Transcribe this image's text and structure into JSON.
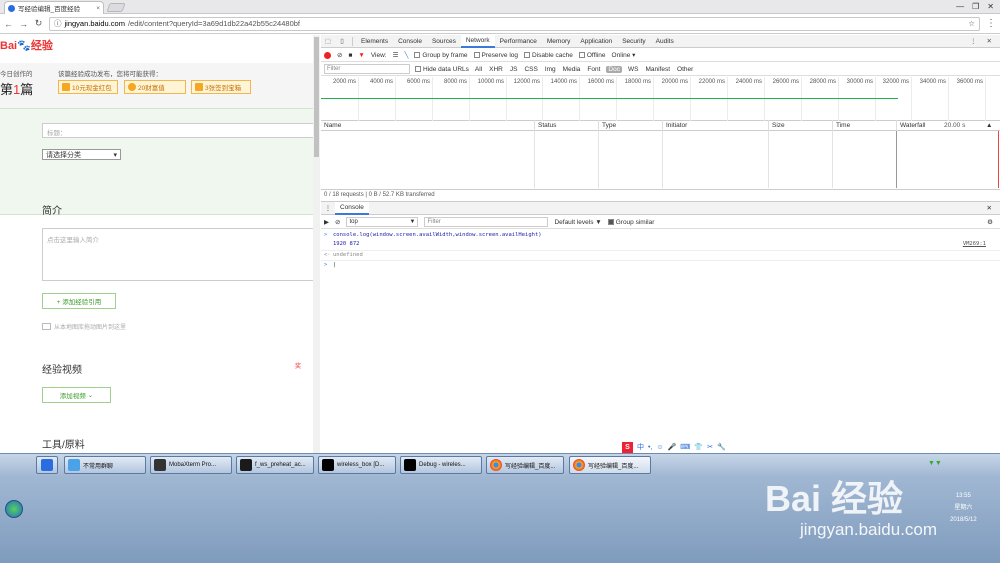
{
  "browser": {
    "tab_title": "写经验编辑_百度经验",
    "tab_close": "×",
    "window_controls": [
      "—",
      "❐",
      "✕"
    ],
    "url_prefix": "jingyan.baidu.com",
    "url_rest": "/edit/content?queryId=3a69d1db22a42b55c24480bf"
  },
  "page": {
    "logo_text": "Bai",
    "logo_suffix": "经验",
    "created_label": "今日创作的",
    "first_label_a": "第",
    "first_label_num": "1",
    "first_label_b": "篇",
    "reward_text": "该篇经验成功发布，您将可能获得：",
    "rewards": [
      "10元现金红包",
      "20财富值",
      "3张签到宝箱"
    ],
    "title_placeholder": "标题：",
    "category": "请选择分类",
    "intro_heading": "简介",
    "intro_placeholder": "点击这里输入简介",
    "add_quote_btn": "+ 添加经验引用",
    "image_note": "从本地图库拖动图片到这里",
    "video_heading": "经验视频",
    "video_badge": "奖",
    "add_video_btn": "添加视频",
    "tools_heading": "工具/原料"
  },
  "devtools": {
    "tabs": [
      "Elements",
      "Console",
      "Sources",
      "Network",
      "Performance",
      "Memory",
      "Application",
      "Security",
      "Audits"
    ],
    "active_tab": "Network",
    "toolbar": {
      "view_label": "View:",
      "group_by_frame": "Group by frame",
      "preserve_log": "Preserve log",
      "disable_cache": "Disable cache",
      "offline": "Offline",
      "online": "Online"
    },
    "filter_placeholder": "Filter",
    "hide_data_urls": "Hide data URLs",
    "type_filters": [
      "All",
      "XHR",
      "JS",
      "CSS",
      "Img",
      "Media",
      "Font",
      "Doc",
      "WS",
      "Manifest",
      "Other"
    ],
    "selected_type": "Doc",
    "timeline_ticks": [
      "2000 ms",
      "4000 ms",
      "6000 ms",
      "8000 ms",
      "10000 ms",
      "12000 ms",
      "14000 ms",
      "16000 ms",
      "18000 ms",
      "20000 ms",
      "22000 ms",
      "24000 ms",
      "26000 ms",
      "28000 ms",
      "30000 ms",
      "32000 ms",
      "34000 ms",
      "36000 ms"
    ],
    "columns": [
      "Name",
      "Status",
      "Type",
      "Initiator",
      "Size",
      "Time",
      "Waterfall"
    ],
    "waterfall_time": "20.00 s",
    "status_bar": "0 / 18 requests  |  0 B / 52.7 KB transferred",
    "drawer_tab": "Console",
    "context": "top",
    "console_filter_placeholder": "Filter",
    "levels": "Default levels ▼",
    "group_similar": "Group similar",
    "console_lines": [
      {
        "prompt": ">",
        "text": "console.log(window.screen.availWidth,window.screen.availHeight)",
        "color": "#1a1aa6"
      },
      {
        "prompt": "",
        "text": "1920 872",
        "color": "#1a1aa6",
        "source": "VM269:1"
      },
      {
        "prompt": "<·",
        "text": "undefined",
        "color": "#888888"
      },
      {
        "prompt": ">",
        "text": "|",
        "color": "#222222"
      }
    ]
  },
  "taskbar": {
    "items": [
      "不常用群聊",
      "MobaXterm Pro...",
      "f_ws_preheat_ac...",
      "wireless_box [D...",
      "Debug - wireles...",
      "写经验编辑_百度...",
      "写经验编辑_百度..."
    ],
    "clock_time": "13:55",
    "clock_day": "星期六",
    "clock_date": "2018/5/12",
    "watermark": "Bai 经验",
    "watermark_url": "jingyan.baidu.com"
  },
  "ime_tray": [
    "S",
    "中",
    "•,",
    "☺",
    "🎤",
    "⌨",
    "👕",
    "✂",
    "🔧"
  ]
}
